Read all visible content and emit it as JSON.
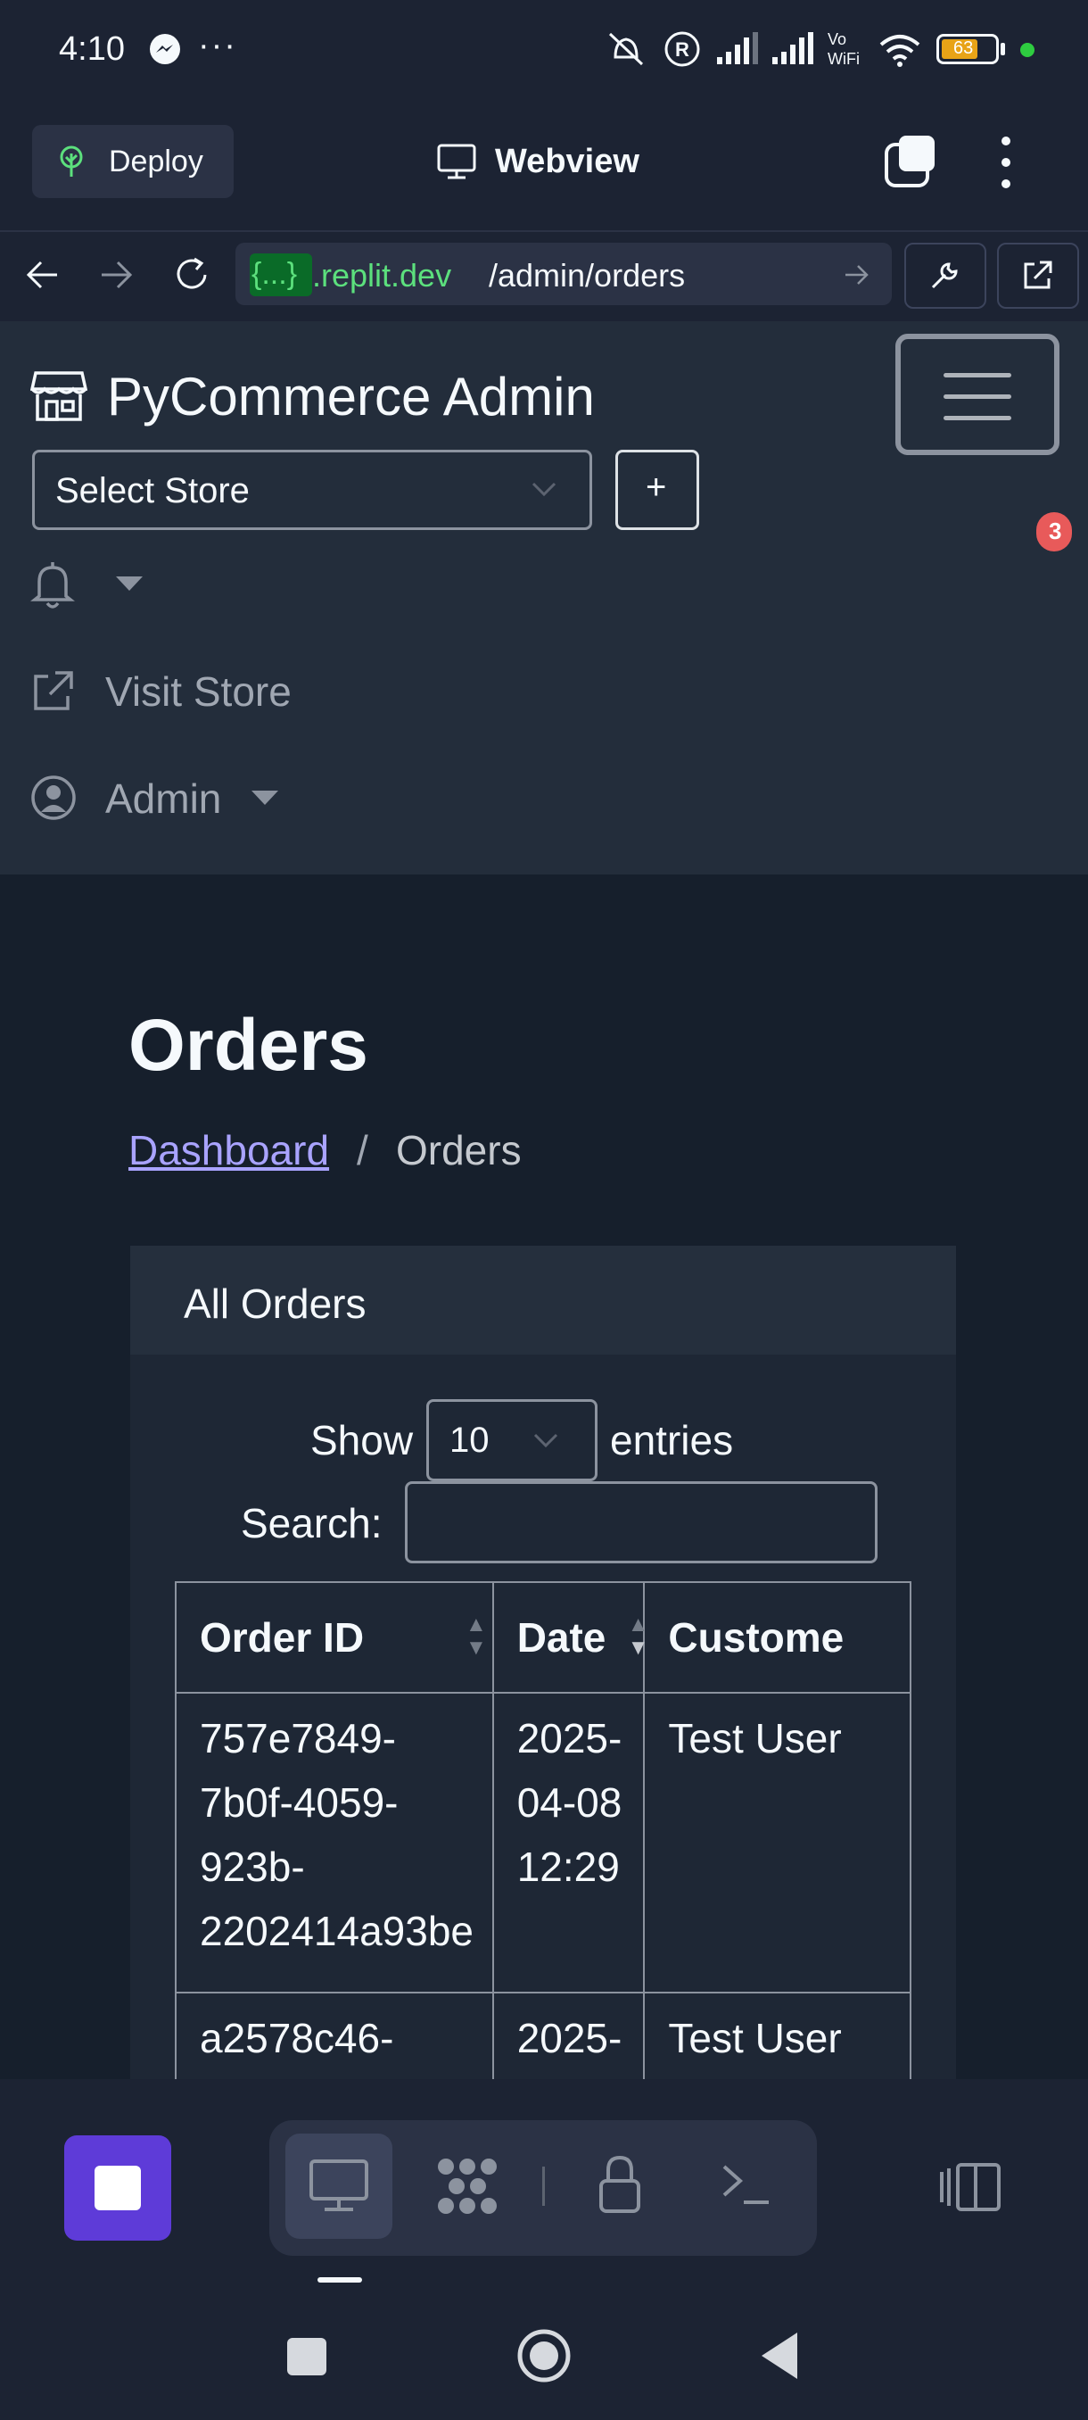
{
  "status_bar": {
    "time": "4:10",
    "more": "···",
    "battery": "63"
  },
  "replit_header": {
    "deploy_label": "Deploy",
    "title": "Webview"
  },
  "url_bar": {
    "host_badge": "{...}",
    "host": ".replit.dev",
    "path": "/admin/orders"
  },
  "site_nav": {
    "brand": "PyCommerce Admin",
    "store_select": "Select Store",
    "add_store_label": "+",
    "notification_count": "3",
    "visit_store": "Visit Store",
    "admin_menu": "Admin"
  },
  "page": {
    "title": "Orders",
    "breadcrumb": {
      "dashboard": "Dashboard",
      "separator": "/",
      "current": "Orders"
    }
  },
  "orders_card": {
    "header": "All Orders",
    "show_label": "Show",
    "page_length": "10",
    "entries_label": "entries",
    "search_label": "Search:",
    "columns": [
      "Order ID",
      "Date",
      "Custome"
    ],
    "rows": [
      {
        "order_id": [
          "757e7849-",
          "7b0f-4059-",
          "923b-",
          "2202414a93be"
        ],
        "date": [
          "2025-",
          "04-08",
          "12:29"
        ],
        "customer": "Test User"
      },
      {
        "order_id": [
          "a2578c46-"
        ],
        "date": [
          "2025-"
        ],
        "customer": "Test User"
      }
    ]
  },
  "colors": {
    "accent": "#5e3bd8",
    "link": "#a9a3ff",
    "host_green": "#5ce07d",
    "badge": "#e85a5a"
  },
  "icons": [
    "storefront-icon",
    "bell-icon",
    "external-link-icon",
    "user-circle-icon",
    "monitor-icon",
    "wrench-icon"
  ]
}
